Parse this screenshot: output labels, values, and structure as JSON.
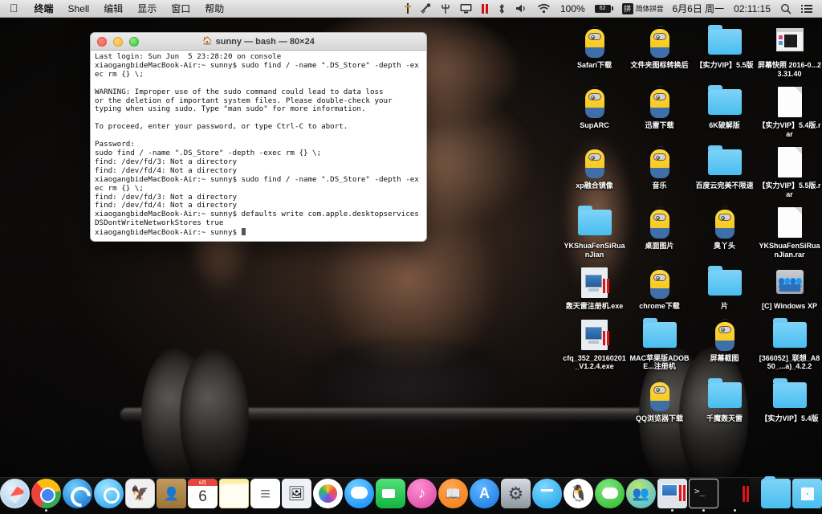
{
  "menubar": {
    "apple_icon": "apple-icon",
    "items": [
      {
        "label": "终端",
        "bold": true
      },
      {
        "label": "Shell",
        "bold": false
      },
      {
        "label": "编辑",
        "bold": false
      },
      {
        "label": "显示",
        "bold": false
      },
      {
        "label": "窗口",
        "bold": false
      },
      {
        "label": "帮助",
        "bold": false
      }
    ],
    "status_icons": [
      "dagger-icon",
      "clamp-icon",
      "pitchfork-icon",
      "screen-sharing-icon",
      "pause-bars-icon",
      "bluetooth-icon",
      "volume-icon",
      "wifi-icon"
    ],
    "battery_percent": "100%",
    "battery_icon_label": "62",
    "input_method_glyph": "拼",
    "input_method_label": "简体拼音",
    "date": "6月6日 周一",
    "time": "02:11:15",
    "search_icon": "search-icon",
    "notification_icon": "notification-center-icon"
  },
  "terminal": {
    "title": "sunny — bash — 80×24",
    "home_icon": "home-folder-icon",
    "traffic_lights": [
      "close-button",
      "minimize-button",
      "zoom-button"
    ],
    "content": "Last login: Sun Jun  5 23:28:20 on console\nxiaogangbideMacBook-Air:~ sunny$ sudo find / -name \".DS_Store\" -depth -exec rm {} \\;\n\nWARNING: Improper use of the sudo command could lead to data loss\nor the deletion of important system files. Please double-check your\ntyping when using sudo. Type \"man sudo\" for more information.\n\nTo proceed, enter your password, or type Ctrl-C to abort.\n\nPassword:\nsudo find / -name \".DS_Store\" -depth -exec rm {} \\;\nfind: /dev/fd/3: Not a directory\nfind: /dev/fd/4: Not a directory\nxiaogangbideMacBook-Air:~ sunny$ sudo find / -name \".DS_Store\" -depth -exec rm {} \\;\nfind: /dev/fd/3: Not a directory\nfind: /dev/fd/4: Not a directory\nxiaogangbideMacBook-Air:~ sunny$ defaults write com.apple.desktopservices DSDontWriteNetworkStores true\nxiaogangbideMacBook-Air:~ sunny$ "
  },
  "desktop_icons": [
    [
      {
        "label": "Safari下载",
        "kind": "minion"
      },
      {
        "label": "文件夹图标转换后",
        "kind": "minion"
      },
      {
        "label": "【实力VIP】5.5版",
        "kind": "folder"
      },
      {
        "label": "屏幕快照 2016-0...23.31.40",
        "kind": "screenshot"
      }
    ],
    [
      {
        "label": "SupARC",
        "kind": "minion"
      },
      {
        "label": "迅雷下载",
        "kind": "minion"
      },
      {
        "label": "6K破解版",
        "kind": "folder"
      },
      {
        "label": "【实力VIP】5.4版.rar",
        "kind": "archive"
      }
    ],
    [
      {
        "label": "xp融合镜像",
        "kind": "minion"
      },
      {
        "label": "音乐",
        "kind": "minion"
      },
      {
        "label": "百度云完美不限速",
        "kind": "folder"
      },
      {
        "label": "【实力VIP】5.5版.rar",
        "kind": "archive"
      }
    ],
    [
      {
        "label": "YKShuaFenSiRuanJian",
        "kind": "folder"
      },
      {
        "label": "桌面图片",
        "kind": "minion"
      },
      {
        "label": "臭丫头",
        "kind": "minion"
      },
      {
        "label": "YKShuaFenSiRuanJian.rar",
        "kind": "archive"
      }
    ],
    [
      {
        "label": "轰天雷注册机.exe",
        "kind": "exe"
      },
      {
        "label": "chrome下载",
        "kind": "minion"
      },
      {
        "label": "片",
        "kind": "folder"
      },
      {
        "label": "[C] Windows XP",
        "kind": "harddrive"
      }
    ],
    [
      {
        "label": "cfq_352_20160201_V1.2.4.exe",
        "kind": "exe"
      },
      {
        "label": "MAC苹果版ADOBE...注册机",
        "kind": "folder"
      },
      {
        "label": "屏幕截图",
        "kind": "minion"
      },
      {
        "label": "[366052]_联想_A850_...a)_4.2.2",
        "kind": "folder"
      }
    ],
    [
      {
        "label": "",
        "kind": "empty"
      },
      {
        "label": "QQ浏览器下载",
        "kind": "minion"
      },
      {
        "label": "千魔轰天雷",
        "kind": "folder"
      },
      {
        "label": "【实力VIP】5.4版",
        "kind": "folder"
      }
    ]
  ],
  "dock": {
    "items": [
      {
        "name": "finder",
        "running": true
      },
      {
        "name": "launchpad",
        "running": false
      },
      {
        "name": "safari",
        "running": false
      },
      {
        "name": "google-chrome",
        "running": true
      },
      {
        "name": "browser-swirl",
        "running": false
      },
      {
        "name": "qq-browser",
        "running": false
      },
      {
        "name": "photos-preview",
        "running": false
      },
      {
        "name": "contacts",
        "running": false
      },
      {
        "name": "calendar",
        "running": false
      },
      {
        "name": "notes",
        "running": false
      },
      {
        "name": "reminders",
        "running": false
      },
      {
        "name": "image-viewer",
        "running": false
      },
      {
        "name": "photos",
        "running": false
      },
      {
        "name": "messages",
        "running": false
      },
      {
        "name": "facetime",
        "running": false
      },
      {
        "name": "itunes",
        "running": false
      },
      {
        "name": "ibooks",
        "running": false
      },
      {
        "name": "app-store",
        "running": false
      },
      {
        "name": "system-preferences",
        "running": false
      },
      {
        "name": "aliwangwang",
        "running": false
      },
      {
        "name": "qq",
        "running": false
      },
      {
        "name": "wechat",
        "running": false
      },
      {
        "name": "msn-messenger",
        "running": false
      },
      {
        "name": "remote-desktop",
        "running": true
      },
      {
        "name": "terminal",
        "running": true
      },
      {
        "name": "code-editor",
        "running": true
      }
    ],
    "right_items": [
      {
        "name": "downloads-folder"
      },
      {
        "name": "windows-folder"
      },
      {
        "name": "document-stack"
      },
      {
        "name": "trash"
      }
    ],
    "calendar_month": "6月",
    "calendar_day": "6"
  },
  "colors": {
    "accent_folder": "#49bdf0",
    "menubar_bg": "#d8d8d8",
    "terminal_bg": "#ffffff",
    "alert_red": "#cc1111"
  }
}
